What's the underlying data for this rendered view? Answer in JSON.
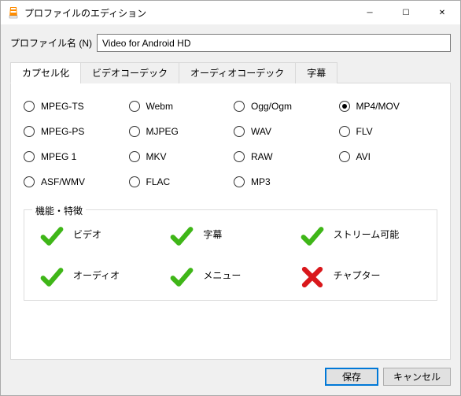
{
  "window": {
    "title": "プロファイルのエディション"
  },
  "profile": {
    "label": "プロファイル名 (N)",
    "value": "Video for Android HD"
  },
  "tabs": [
    {
      "label": "カプセル化",
      "active": true
    },
    {
      "label": "ビデオコーデック",
      "active": false
    },
    {
      "label": "オーディオコーデック",
      "active": false
    },
    {
      "label": "字幕",
      "active": false
    }
  ],
  "formats": [
    {
      "label": "MPEG-TS",
      "selected": false
    },
    {
      "label": "Webm",
      "selected": false
    },
    {
      "label": "Ogg/Ogm",
      "selected": false
    },
    {
      "label": "MP4/MOV",
      "selected": true
    },
    {
      "label": "MPEG-PS",
      "selected": false
    },
    {
      "label": "MJPEG",
      "selected": false
    },
    {
      "label": "WAV",
      "selected": false
    },
    {
      "label": "FLV",
      "selected": false
    },
    {
      "label": "MPEG 1",
      "selected": false
    },
    {
      "label": "MKV",
      "selected": false
    },
    {
      "label": "RAW",
      "selected": false
    },
    {
      "label": "AVI",
      "selected": false
    },
    {
      "label": "ASF/WMV",
      "selected": false
    },
    {
      "label": "FLAC",
      "selected": false
    },
    {
      "label": "MP3",
      "selected": false
    }
  ],
  "features": {
    "heading": "機能・特徴",
    "items": [
      {
        "label": "ビデオ",
        "ok": true
      },
      {
        "label": "字幕",
        "ok": true
      },
      {
        "label": "ストリーム可能",
        "ok": true
      },
      {
        "label": "オーディオ",
        "ok": true
      },
      {
        "label": "メニュー",
        "ok": true
      },
      {
        "label": "チャプター",
        "ok": false
      }
    ]
  },
  "buttons": {
    "save": "保存",
    "cancel": "キャンセル"
  }
}
